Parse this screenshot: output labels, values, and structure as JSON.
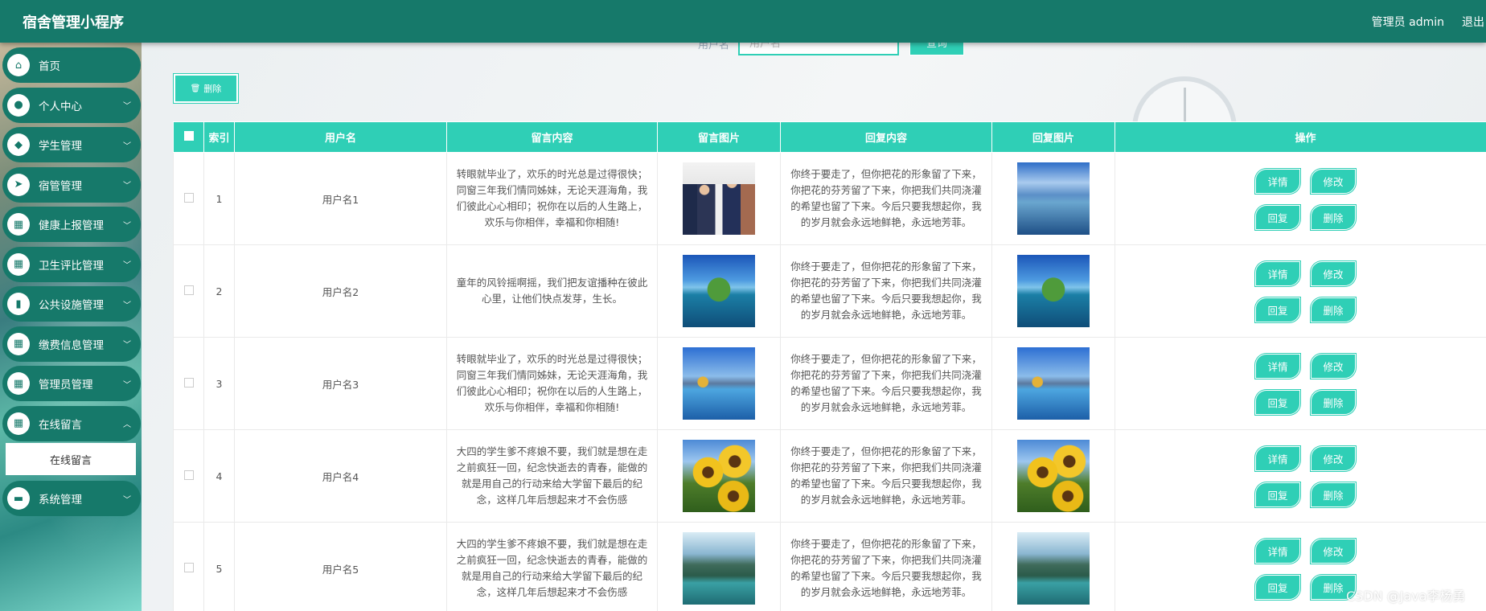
{
  "header": {
    "title": "宿舍管理小程序",
    "admin_label": "管理员 admin",
    "logout": "退出"
  },
  "sidebar": {
    "items": [
      {
        "label": "首页",
        "icon": "home-icon",
        "glyph": "⌂",
        "has_arrow": false
      },
      {
        "label": "个人中心",
        "icon": "user-icon",
        "glyph": "●",
        "has_arrow": true
      },
      {
        "label": "学生管理",
        "icon": "leaf-icon",
        "glyph": "◆",
        "has_arrow": true
      },
      {
        "label": "宿管管理",
        "icon": "send-icon",
        "glyph": "➤",
        "has_arrow": true
      },
      {
        "label": "健康上报管理",
        "icon": "grid-icon",
        "glyph": "▦",
        "has_arrow": true
      },
      {
        "label": "卫生评比管理",
        "icon": "grid-icon",
        "glyph": "▦",
        "has_arrow": true
      },
      {
        "label": "公共设施管理",
        "icon": "book-icon",
        "glyph": "▮",
        "has_arrow": true
      },
      {
        "label": "缴费信息管理",
        "icon": "grid-icon",
        "glyph": "▦",
        "has_arrow": true
      },
      {
        "label": "管理员管理",
        "icon": "grid-icon",
        "glyph": "▦",
        "has_arrow": true
      },
      {
        "label": "在线留言",
        "icon": "grid-icon",
        "glyph": "▦",
        "has_arrow": true,
        "expanded": true,
        "sub": "在线留言"
      },
      {
        "label": "系统管理",
        "icon": "wallet-icon",
        "glyph": "▬",
        "has_arrow": true
      }
    ]
  },
  "toolbar": {
    "search_label": "用户名",
    "search_placeholder": "用户名",
    "search_button": "查询",
    "delete_button": "删除",
    "delete_icon": "🗑"
  },
  "table": {
    "headers": [
      "",
      "索引",
      "用户名",
      "留言内容",
      "留言图片",
      "回复内容",
      "回复图片",
      "操作"
    ],
    "ops": [
      "详情",
      "修改",
      "回复",
      "删除"
    ],
    "rows": [
      {
        "index": "1",
        "username": "用户名1",
        "content": "转眼就毕业了，欢乐的时光总是过得很快；同窗三年我们情同姊妹，无论天涯海角，我们彼此心心相印；祝你在以后的人生路上，欢乐与你相伴，幸福和你相随!",
        "img": "students",
        "reply": "你终于要走了，但你把花的形象留了下来，你把花的芬芳留了下来，你把我们共同浇灌的希望也留了下来。今后只要我想起你，我的岁月就会永远地鲜艳，永远地芳菲。",
        "reply_img": "sky"
      },
      {
        "index": "2",
        "username": "用户名2",
        "content": "童年的风铃摇啊摇，我们把友谊播种在彼此心里，让他们快点发芽，生长。",
        "img": "island",
        "reply": "你终于要走了，但你把花的形象留了下来，你把花的芬芳留了下来，你把我们共同浇灌的希望也留了下来。今后只要我想起你，我的岁月就会永远地鲜艳，永远地芳菲。",
        "reply_img": "island"
      },
      {
        "index": "3",
        "username": "用户名3",
        "content": "转眼就毕业了，欢乐的时光总是过得很快；同窗三年我们情同姊妹，无论天涯海角，我们彼此心心相印；祝你在以后的人生路上，欢乐与你相伴，幸福和你相随!",
        "img": "lake",
        "reply": "你终于要走了，但你把花的形象留了下来，你把花的芬芳留了下来，你把我们共同浇灌的希望也留了下来。今后只要我想起你，我的岁月就会永远地鲜艳，永远地芳菲。",
        "reply_img": "lake"
      },
      {
        "index": "4",
        "username": "用户名4",
        "content": "大四的学生爹不疼娘不要，我们就是想在走之前疯狂一回，纪念快逝去的青春，能做的就是用自己的行动来给大学留下最后的纪念，这样几年后想起来才不会伤感",
        "img": "sunflower",
        "reply": "你终于要走了，但你把花的形象留了下来，你把花的芬芳留了下来，你把我们共同浇灌的希望也留了下来。今后只要我想起你，我的岁月就会永远地鲜艳，永远地芳菲。",
        "reply_img": "sunflower"
      },
      {
        "index": "5",
        "username": "用户名5",
        "content": "大四的学生爹不疼娘不要，我们就是想在走之前疯狂一回，纪念快逝去的青春，能做的就是用自己的行动来给大学留下最后的纪念，这样几年后想起来才不会伤感",
        "img": "mountain",
        "reply": "你终于要走了，但你把花的形象留了下来，你把花的芬芳留了下来，你把我们共同浇灌的希望也留了下来。今后只要我想起你，我的岁月就会永远地鲜艳，永远地芳菲。",
        "reply_img": "mountain"
      }
    ]
  },
  "watermark": "CSDN @Java李杨勇",
  "colors": {
    "header": "#16796a",
    "accent": "#2fcfb6"
  }
}
